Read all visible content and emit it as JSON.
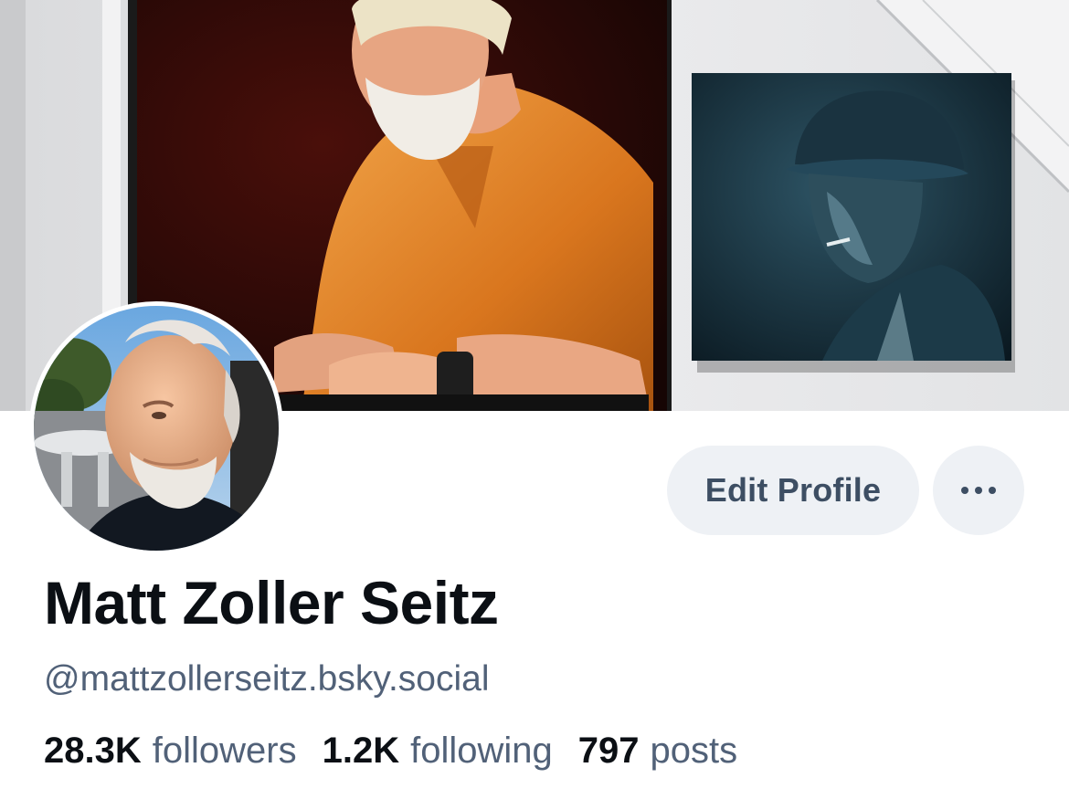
{
  "profile": {
    "display_name": "Matt Zoller Seitz",
    "handle": "@mattzollerseitz.bsky.social"
  },
  "actions": {
    "edit_profile_label": "Edit Profile",
    "more_icon": "ellipsis-icon"
  },
  "stats": {
    "followers_count": "28.3K",
    "followers_label": "followers",
    "following_count": "1.2K",
    "following_label": "following",
    "posts_count": "797",
    "posts_label": "posts"
  },
  "colors": {
    "button_bg": "#eef1f5",
    "button_text": "#3d4e63",
    "secondary_text": "#516178",
    "primary_text": "#0b0f14"
  }
}
